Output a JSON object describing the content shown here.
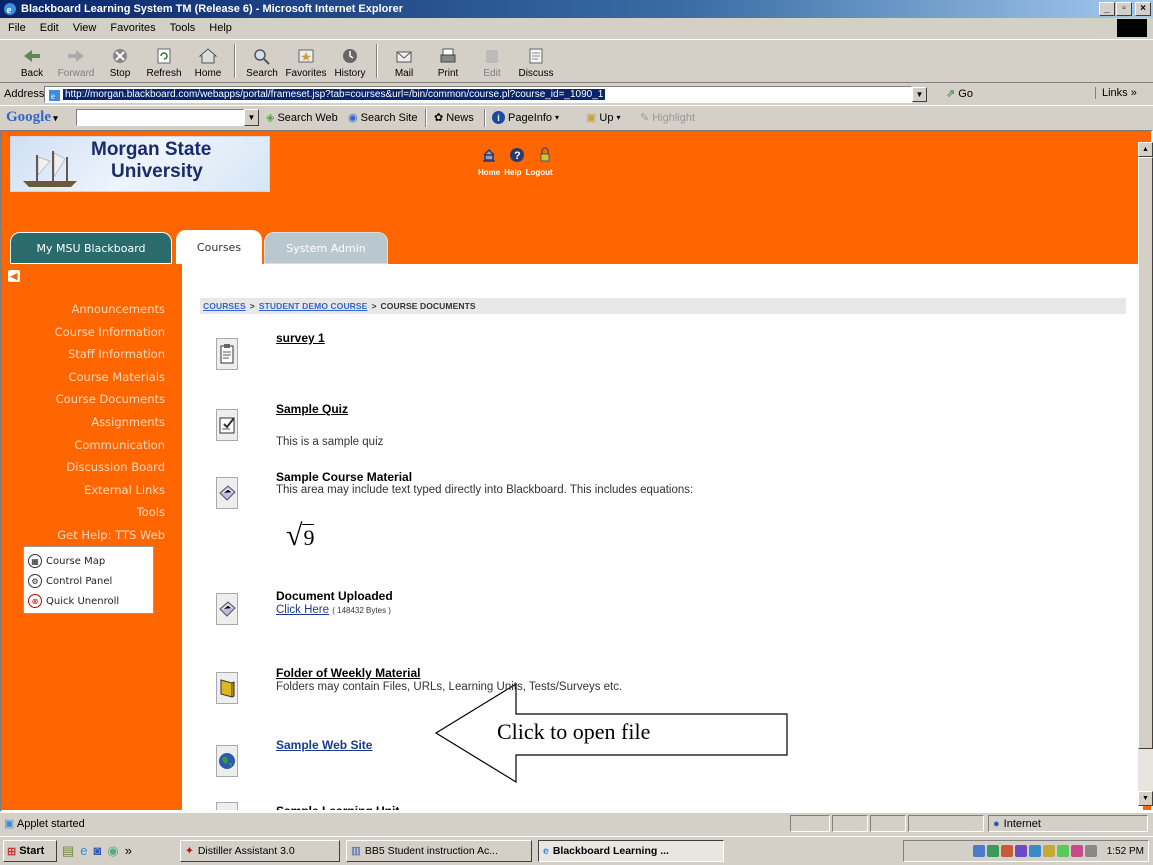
{
  "window": {
    "title": "Blackboard Learning System TM (Release 6) - Microsoft Internet Explorer",
    "minimize": "_",
    "maximize": "▫",
    "close": "×"
  },
  "menu": [
    "File",
    "Edit",
    "View",
    "Favorites",
    "Tools",
    "Help"
  ],
  "toolbar": [
    {
      "label": "Back",
      "icon": "back-arrow-icon",
      "disabled": false
    },
    {
      "label": "Forward",
      "icon": "forward-arrow-icon",
      "disabled": true
    },
    {
      "label": "Stop",
      "icon": "stop-icon",
      "disabled": false
    },
    {
      "label": "Refresh",
      "icon": "refresh-icon",
      "disabled": false
    },
    {
      "label": "Home",
      "icon": "home-icon",
      "disabled": false
    },
    {
      "label": "Search",
      "icon": "search-icon",
      "disabled": false
    },
    {
      "label": "Favorites",
      "icon": "favorites-icon",
      "disabled": false
    },
    {
      "label": "History",
      "icon": "history-icon",
      "disabled": false
    },
    {
      "label": "Mail",
      "icon": "mail-icon",
      "disabled": false
    },
    {
      "label": "Print",
      "icon": "print-icon",
      "disabled": false
    },
    {
      "label": "Edit",
      "icon": "edit-icon",
      "disabled": true
    },
    {
      "label": "Discuss",
      "icon": "discuss-icon",
      "disabled": false
    }
  ],
  "address": {
    "label": "Address",
    "url": "http://morgan.blackboard.com/webapps/portal/frameset.jsp?tab=courses&url=/bin/common/course.pl?course_id=_1090_1",
    "go": "Go",
    "links": "Links »"
  },
  "google_bar": {
    "logo": "Google",
    "search_web": "Search Web",
    "search_site": "Search Site",
    "news": "News",
    "page_info": "PageInfo",
    "up": "Up",
    "highlight": "Highlight"
  },
  "site": {
    "logo_line1": "Morgan State",
    "logo_line2": "University",
    "top_links": [
      "Home",
      "Help",
      "Logout"
    ],
    "tabs": [
      "My MSU Blackboard",
      "Courses",
      "System Admin"
    ],
    "nav": [
      "Announcements",
      "Course Information",
      "Staff Information",
      "Course Materials",
      "Course Documents",
      "Assignments",
      "Communication",
      "Discussion Board",
      "External Links",
      "Tools",
      "Get Help: TTS Web"
    ],
    "toolbox": [
      "Course Map",
      "Control Panel",
      "Quick Unenroll"
    ],
    "breadcrumb": {
      "courses": "COURSES",
      "course": "STUDENT DEMO COURSE",
      "current": "COURSE DOCUMENTS",
      "separator": ">"
    }
  },
  "items": [
    {
      "title": "survey 1",
      "desc": ""
    },
    {
      "title": "Sample Quiz",
      "desc": "This is a sample quiz"
    },
    {
      "title": "Sample Course Material",
      "desc": "This area may include text typed directly into Blackboard. This includes equations:"
    },
    {
      "title": "Document Uploaded",
      "link": "Click Here",
      "size": "( 148432 Bytes )"
    },
    {
      "title": "Folder of Weekly Material",
      "desc": "Folders may contain Files, URLs, Learning Units, Tests/Surveys etc."
    },
    {
      "title": "Sample Web Site",
      "desc": ""
    },
    {
      "title": "Sample Learning Unit",
      "desc": ""
    }
  ],
  "equation": {
    "radical": "√",
    "value": "9"
  },
  "callout": "Click to open file",
  "status": {
    "message": "Applet started",
    "zone": "Internet"
  },
  "taskbar": {
    "start": "Start",
    "tasks": [
      "Distiller Assistant 3.0",
      "BB5 Student instruction Ac...",
      "Blackboard Learning ..."
    ],
    "quick_more": "»",
    "clock": "1:52 PM"
  }
}
